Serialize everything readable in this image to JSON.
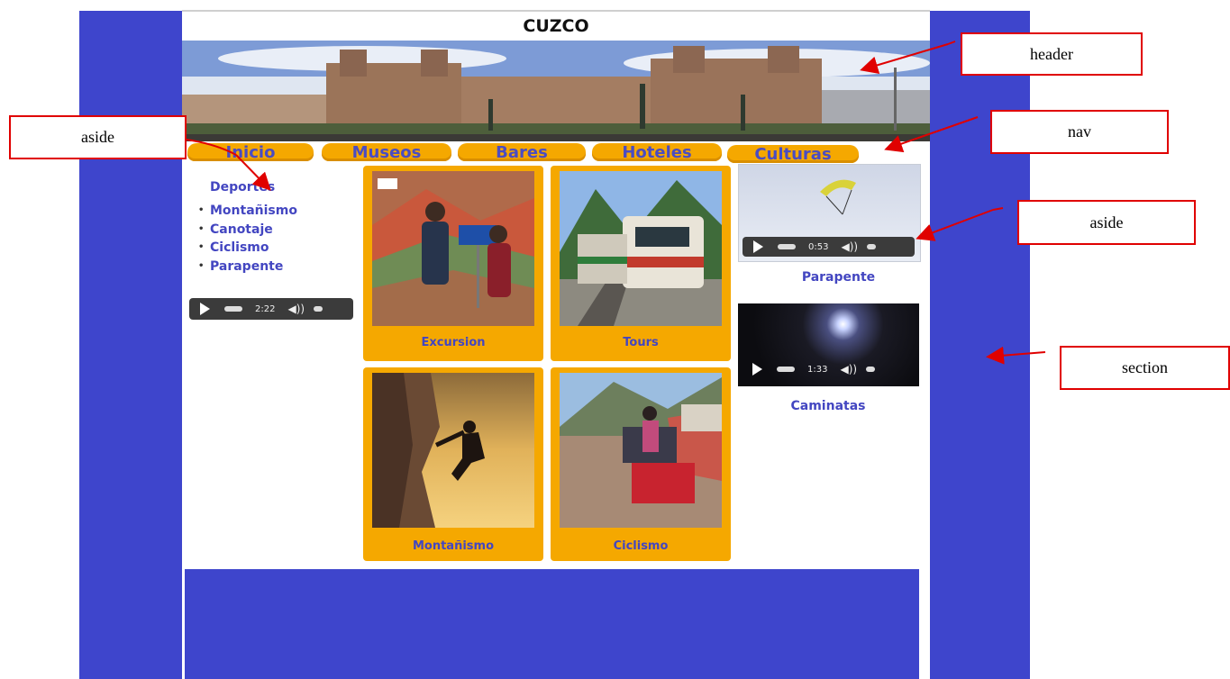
{
  "header": {
    "title": "CUZCO"
  },
  "nav": {
    "items": [
      "Inicio",
      "Museos",
      "Bares",
      "Hoteles",
      "Culturas"
    ]
  },
  "left_aside": {
    "title": "Deportes",
    "items": [
      "Montañismo",
      "Canotaje",
      "Ciclismo",
      "Parapente"
    ],
    "player_time": "2:22"
  },
  "section": {
    "cards": [
      {
        "caption": "Excursion"
      },
      {
        "caption": "Tours"
      },
      {
        "caption": "Montañismo"
      },
      {
        "caption": "Ciclismo"
      }
    ]
  },
  "right_aside": {
    "videos": [
      {
        "time": "0:53",
        "label": "Parapente"
      },
      {
        "time": "1:33",
        "label": "Caminatas"
      }
    ]
  },
  "annotations": {
    "header": "header",
    "nav": "nav",
    "aside_left": "aside",
    "aside_right": "aside",
    "section": "section"
  },
  "colors": {
    "page_bg": "#3e45cc",
    "accent": "#f5a800",
    "link": "#4346c1",
    "annotation_border": "#e00000"
  }
}
